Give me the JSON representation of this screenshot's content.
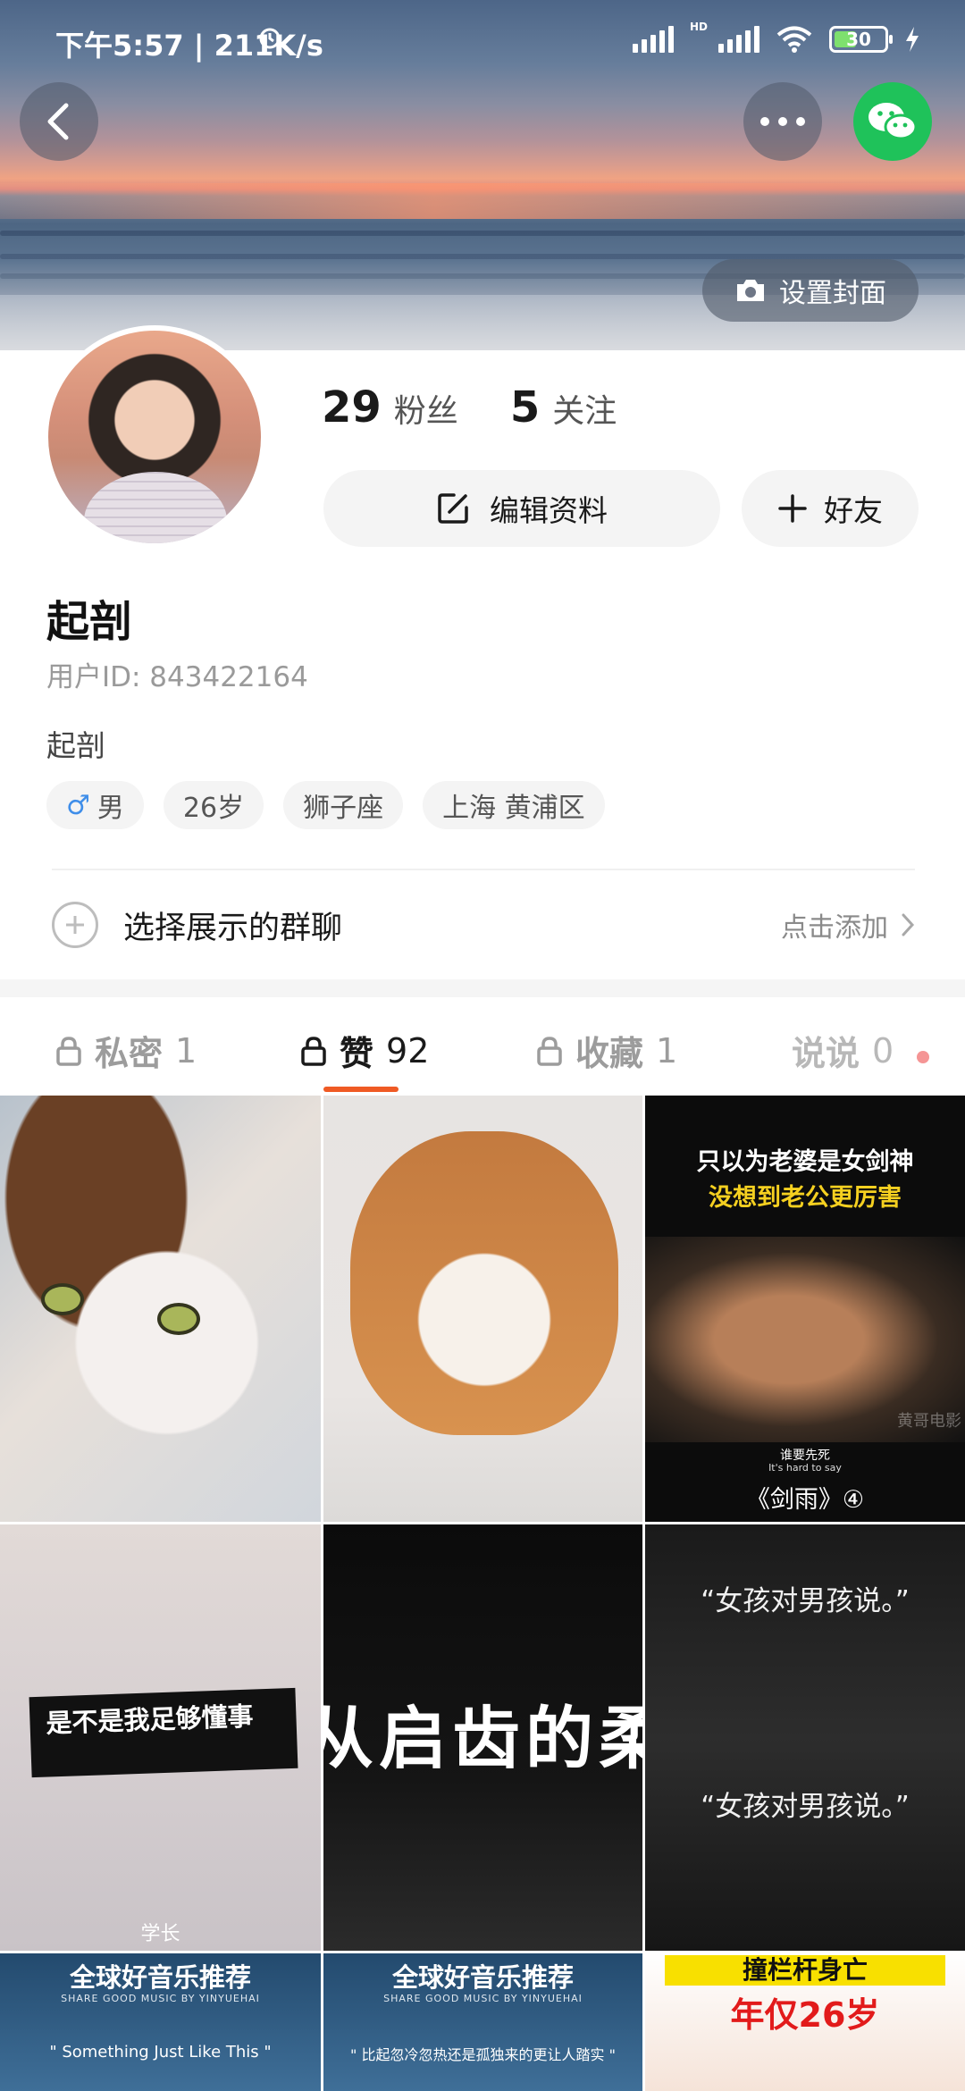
{
  "status_bar": {
    "time": "下午5:57 | 211K/s",
    "battery": "30",
    "hd": "HD"
  },
  "header": {
    "cover_button_label": "设置封面"
  },
  "profile": {
    "followers_count": "29",
    "followers_label": "粉丝",
    "following_count": "5",
    "following_label": "关注",
    "edit_label": "编辑资料",
    "add_friend_label": "好友",
    "nickname": "起剖",
    "user_id": "用户ID: 843422164",
    "bio": "起剖",
    "tags": {
      "gender_symbol": "♂",
      "gender": "男",
      "age": "26岁",
      "zodiac": "狮子座",
      "location": "上海 黄浦区"
    }
  },
  "group_chat": {
    "label": "选择展示的群聊",
    "action": "点击添加"
  },
  "tabs": [
    {
      "label": "私密",
      "count": "1"
    },
    {
      "label": "赞",
      "count": "92"
    },
    {
      "label": "收藏",
      "count": "1"
    },
    {
      "label": "说说",
      "count": "0"
    }
  ],
  "grid": {
    "c3_line1": "只以为老婆是女剑神",
    "c3_line2": "没想到老公更厉害",
    "c3_sub_cn": "谁要先死",
    "c3_sub_en": "It's hard to say",
    "c3_title": "《剑雨》④",
    "c3_watermark": "黄哥电影",
    "c4_caption": "是不是我足够懂事",
    "c4_bottom": "学长",
    "c5_text": "从启齿的柔",
    "c6_caption_1": "“女孩对男孩说。”",
    "c6_caption_2": "“女孩对男孩说。”",
    "c7_title": "全球好音乐推荐",
    "c7_sub": "SHARE GOOD MUSIC BY YINYUEHAI",
    "c7_quote": "\" Something Just Like This \"",
    "c8_title": "全球好音乐推荐",
    "c8_sub": "SHARE GOOD MUSIC BY YINYUEHAI",
    "c8_quote": "\" 比起忽冷忽热还是孤独来的更让人踏实 \"",
    "c9_line1": "撞栏杆身亡",
    "c9_line2": "年仅26岁"
  },
  "colors": {
    "accent": "#ef5a24",
    "wechat": "#1fc25a",
    "male": "#3f8ee9"
  },
  "icons": {
    "back": "chevron-left-icon",
    "more": "more-dots-icon",
    "share": "wechat-icon",
    "camera": "camera-icon",
    "edit": "edit-icon",
    "plus": "plus-icon",
    "lock": "lock-icon",
    "arrow": "chevron-right-icon"
  }
}
